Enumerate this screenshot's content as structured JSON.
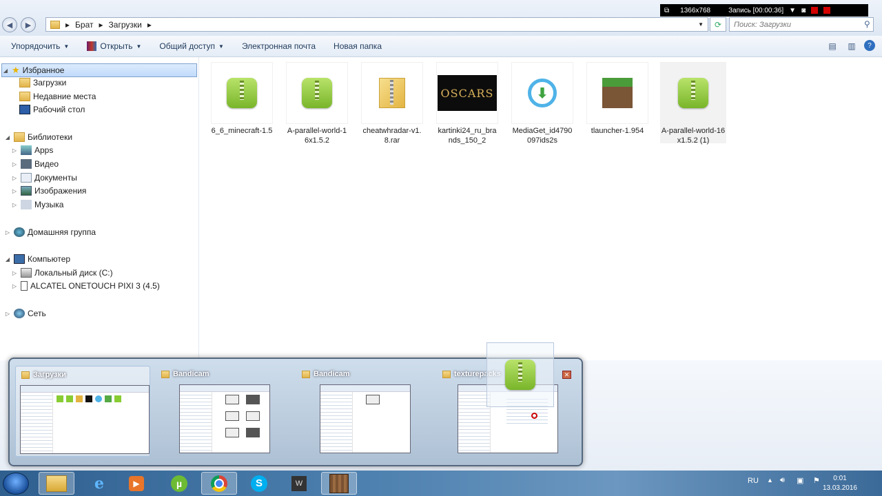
{
  "recorder": {
    "resolution": "1366x768",
    "status": "Запись [00:00:36]"
  },
  "breadcrumb": [
    "Брат",
    "Загрузки"
  ],
  "search": {
    "placeholder": "Поиск: Загрузки"
  },
  "toolbar": {
    "organize": "Упорядочить",
    "open": "Открыть",
    "share": "Общий доступ",
    "email": "Электронная почта",
    "new_folder": "Новая папка"
  },
  "sidebar": {
    "favorites": "Избранное",
    "downloads": "Загрузки",
    "recent": "Недавние места",
    "desktop": "Рабочий стол",
    "libraries": "Библиотеки",
    "apps": "Apps",
    "video": "Видео",
    "documents": "Документы",
    "images": "Изображения",
    "music": "Музыка",
    "homegroup": "Домашняя группа",
    "computer": "Компьютер",
    "local_disk": "Локальный диск (C:)",
    "phone": "ALCATEL ONETOUCH PIXI 3 (4.5)",
    "network": "Сеть"
  },
  "files": [
    {
      "name": "6_6_minecraft-1.5",
      "icon": "winrar-archive-icon"
    },
    {
      "name": "A-parallel-world-16x1.5.2",
      "icon": "winrar-archive-icon"
    },
    {
      "name": "cheatwhradar-v1.8.rar",
      "icon": "zip-folder-icon"
    },
    {
      "name": "kartinki24_ru_brands_150_2",
      "icon": "oscars-image-thumbnail",
      "thumb_text": "OSCARS"
    },
    {
      "name": "MediaGet_id4790097ids2s",
      "icon": "mediaget-icon"
    },
    {
      "name": "tlauncher-1.954",
      "icon": "minecraft-grass-block-icon"
    },
    {
      "name": "A-parallel-world-16x1.5.2 (1)",
      "icon": "winrar-archive-icon"
    }
  ],
  "switcher": {
    "windows": [
      {
        "title": "Загрузки"
      },
      {
        "title": "Bandicam"
      },
      {
        "title": "Bandicam"
      },
      {
        "title": "texturepacks"
      }
    ]
  },
  "taskbar": {
    "apps": [
      "explorer",
      "internet-explorer",
      "media-player",
      "utorrent",
      "chrome",
      "skype",
      "world-of-tanks",
      "minecraft"
    ],
    "language": "RU",
    "time": "0:01",
    "date": "13.03.2016"
  }
}
